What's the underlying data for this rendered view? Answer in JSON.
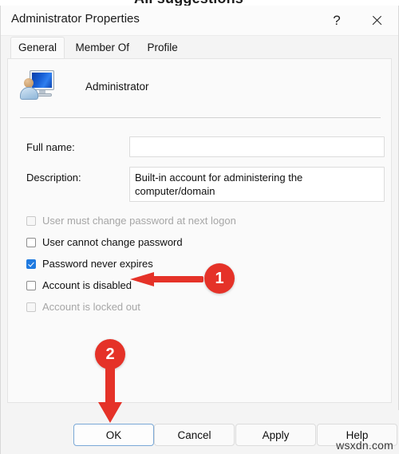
{
  "background": {
    "cut_off_heading": "All suggestions"
  },
  "dialog": {
    "title": "Administrator Properties",
    "titlebar_buttons": [
      {
        "name": "help",
        "glyph": "?"
      },
      {
        "name": "close",
        "glyph": "×"
      }
    ],
    "tabs": [
      {
        "label": "General",
        "active": true
      },
      {
        "label": "Member Of",
        "active": false
      },
      {
        "label": "Profile",
        "active": false
      }
    ],
    "account": {
      "icon": "user-account-icon",
      "name": "Administrator"
    },
    "fields": [
      {
        "label": "Full name:",
        "value": "",
        "placeholder": ""
      },
      {
        "label": "Description:",
        "value": "Built-in account for administering the computer/domain",
        "placeholder": ""
      }
    ],
    "checkboxes": [
      {
        "label": "User must change password at next logon",
        "checked": false,
        "disabled": true
      },
      {
        "label": "User cannot change password",
        "checked": false,
        "disabled": false
      },
      {
        "label": "Password never expires",
        "checked": true,
        "disabled": false
      },
      {
        "label": "Account is disabled",
        "checked": false,
        "disabled": false
      },
      {
        "label": "Account is locked out",
        "checked": false,
        "disabled": true
      }
    ],
    "buttons": [
      {
        "label": "OK",
        "primary": true
      },
      {
        "label": "Cancel",
        "primary": false
      },
      {
        "label": "Apply",
        "primary": false
      },
      {
        "label": "Help",
        "primary": false
      }
    ]
  },
  "annotations": {
    "color": "#e53228",
    "markers": [
      {
        "number": "1",
        "points_at": "Account is disabled"
      },
      {
        "number": "2",
        "points_at": "OK"
      }
    ]
  },
  "watermark": "wsxdn.com"
}
